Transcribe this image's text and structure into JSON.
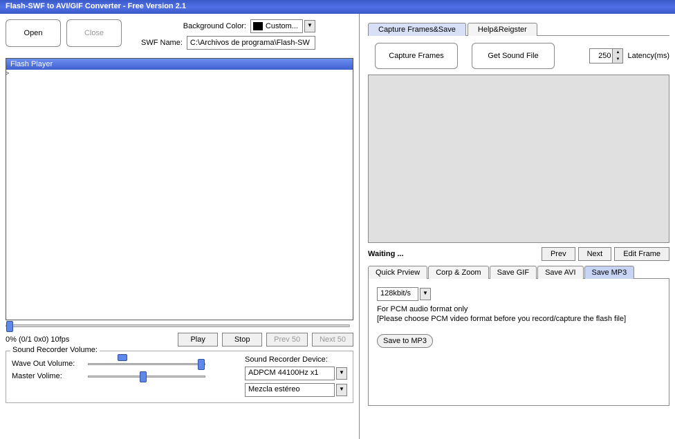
{
  "title": "Flash-SWF to AVI/GIF Converter - Free Version 2.1",
  "buttons": {
    "open": "Open",
    "close": "Close",
    "play": "Play",
    "stop": "Stop",
    "prev50": "Prev 50",
    "next50": "Next 50",
    "captureFrames": "Capture Frames",
    "getSoundFile": "Get Sound File",
    "prev": "Prev",
    "next": "Next",
    "editFrame": "Edit Frame",
    "saveToMp3": "Save to MP3"
  },
  "labels": {
    "bgColor": "Background Color:",
    "swfName": "SWF Name:",
    "latency": "Latency(ms)",
    "soundRecorderVolume": "Sound Recorder Volume:",
    "waveOut": "Wave Out Volume:",
    "masterVol": "Master Volime:",
    "soundRecorderDevice": "Sound Recorder Device:",
    "waiting": "Waiting ..."
  },
  "values": {
    "bgColorOption": "Custom...",
    "swfPath": "C:\\Archivos de programa\\Flash-SW",
    "playerTitle": "Flash Player",
    "status": "0% (0/1 0x0) 10fps",
    "latency": "250",
    "device1": "ADPCM 44100Hz x1",
    "device2": "Mezcla estéreo",
    "bitrate": "128kbit/s",
    "pcmInfo1": "For PCM audio format only",
    "pcmInfo2": "[Please choose PCM video format before you record/capture the flash file]"
  },
  "tabs": {
    "main": [
      "Capture Frames&Save",
      "Help&Reigster"
    ],
    "sub": [
      "Quick Prview",
      "Corp & Zoom",
      "Save GIF",
      "Save AVI",
      "Save MP3"
    ]
  }
}
